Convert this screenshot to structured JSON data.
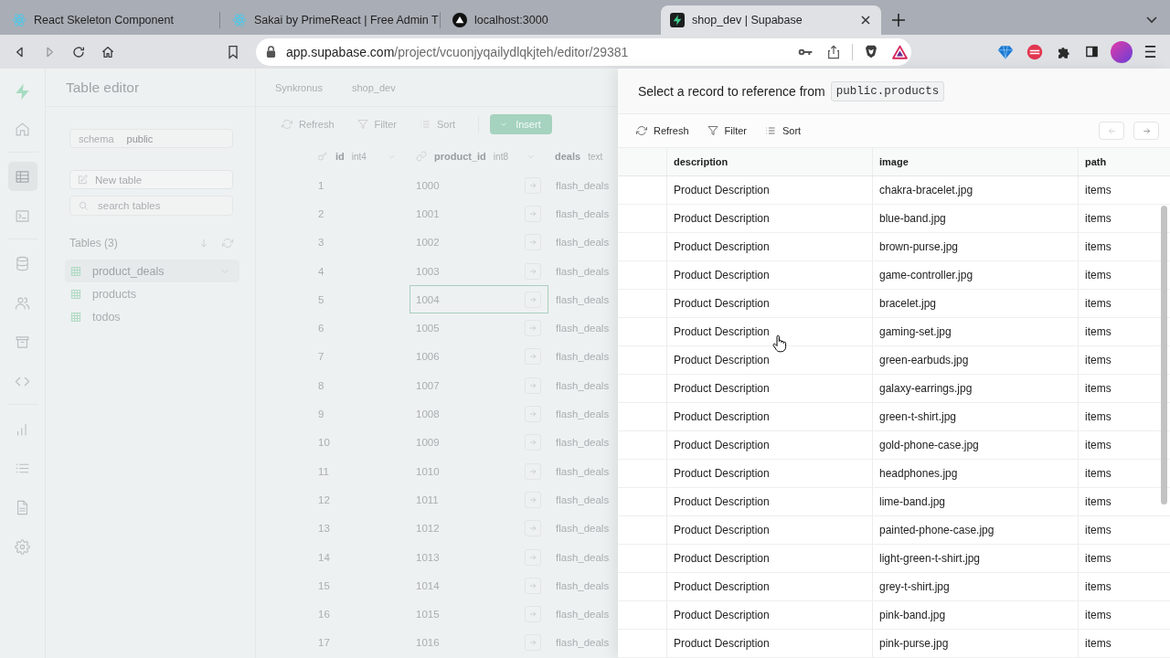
{
  "browser": {
    "tabs": [
      {
        "title": "React Skeleton Component",
        "kind": "atom",
        "selected": false
      },
      {
        "title": "Sakai by PrimeReact | Free Admin T",
        "kind": "atom",
        "selected": false
      },
      {
        "title": "localhost:3000",
        "kind": "triangle",
        "selected": false
      },
      {
        "title": "shop_dev | Supabase",
        "kind": "bolt",
        "selected": true
      }
    ],
    "nav": [
      {
        "kind": "back",
        "disabled": false
      },
      {
        "kind": "forward",
        "disabled": true
      },
      {
        "kind": "reload",
        "disabled": false
      },
      {
        "kind": "home",
        "disabled": false
      }
    ],
    "url": {
      "host": "app.supabase.com",
      "path": "/project/vcuonjyqailydlqkjteh/editor/29381"
    }
  },
  "rail": {
    "groups": [
      [
        {
          "kind": "home",
          "selected": false
        }
      ],
      [
        {
          "kind": "table",
          "selected": true
        },
        {
          "kind": "terminal",
          "selected": false
        }
      ],
      [
        {
          "kind": "database",
          "selected": false
        },
        {
          "kind": "users",
          "selected": false
        },
        {
          "kind": "archive",
          "selected": false
        },
        {
          "kind": "code",
          "selected": false
        }
      ],
      [
        {
          "kind": "chart",
          "selected": false
        },
        {
          "kind": "list",
          "selected": false
        },
        {
          "kind": "document",
          "selected": false
        },
        {
          "kind": "settings",
          "selected": false
        }
      ]
    ]
  },
  "sidebar": {
    "title": "Table editor",
    "schema": {
      "label": "schema",
      "value": "public"
    },
    "new_table": "New table",
    "search": {
      "placeholder": "search tables"
    },
    "tables_heading": "Tables (3)",
    "tables": [
      {
        "name": "product_deals",
        "selected": true
      },
      {
        "name": "products",
        "selected": false
      },
      {
        "name": "todos",
        "selected": false
      }
    ]
  },
  "editor": {
    "breadcrumbs": [
      "Synkronus",
      "shop_dev"
    ],
    "toolbar": {
      "refresh": "Refresh",
      "filter": "Filter",
      "sort": "Sort",
      "insert": "Insert"
    },
    "columns": [
      {
        "name": "id",
        "type": "int4",
        "kind": "key"
      },
      {
        "name": "product_id",
        "type": "int8",
        "kind": "link"
      },
      {
        "name": "deals",
        "type": "text",
        "kind": "plain"
      }
    ],
    "rows": [
      {
        "cells": [
          "1",
          "1000",
          "flash_deals"
        ],
        "selected": false
      },
      {
        "cells": [
          "2",
          "1001",
          "flash_deals"
        ],
        "selected": false
      },
      {
        "cells": [
          "3",
          "1002",
          "flash_deals"
        ],
        "selected": false
      },
      {
        "cells": [
          "4",
          "1003",
          "flash_deals"
        ],
        "selected": false
      },
      {
        "cells": [
          "5",
          "1004",
          "flash_deals"
        ],
        "selected": true
      },
      {
        "cells": [
          "6",
          "1005",
          "flash_deals"
        ],
        "selected": false
      },
      {
        "cells": [
          "7",
          "1006",
          "flash_deals"
        ],
        "selected": false
      },
      {
        "cells": [
          "8",
          "1007",
          "flash_deals"
        ],
        "selected": false
      },
      {
        "cells": [
          "9",
          "1008",
          "flash_deals"
        ],
        "selected": false
      },
      {
        "cells": [
          "10",
          "1009",
          "flash_deals"
        ],
        "selected": false
      },
      {
        "cells": [
          "11",
          "1010",
          "flash_deals"
        ],
        "selected": false
      },
      {
        "cells": [
          "12",
          "1011",
          "flash_deals"
        ],
        "selected": false
      },
      {
        "cells": [
          "13",
          "1012",
          "flash_deals"
        ],
        "selected": false
      },
      {
        "cells": [
          "14",
          "1013",
          "flash_deals"
        ],
        "selected": false
      },
      {
        "cells": [
          "15",
          "1014",
          "flash_deals"
        ],
        "selected": false
      },
      {
        "cells": [
          "16",
          "1015",
          "flash_deals"
        ],
        "selected": false
      },
      {
        "cells": [
          "17",
          "1016",
          "flash_deals"
        ],
        "selected": false
      }
    ]
  },
  "reference_panel": {
    "title": "Select a record to reference from",
    "table": "public.products",
    "toolbar": {
      "refresh": "Refresh",
      "filter": "Filter",
      "sort": "Sort"
    },
    "pager": [
      {
        "kind": "previous",
        "disabled": true
      },
      {
        "kind": "next",
        "disabled": false
      }
    ],
    "columns": [
      "description",
      "image",
      "path"
    ],
    "rows": [
      [
        "Product Description",
        "chakra-bracelet.jpg",
        "items"
      ],
      [
        "Product Description",
        "blue-band.jpg",
        "items"
      ],
      [
        "Product Description",
        "brown-purse.jpg",
        "items"
      ],
      [
        "Product Description",
        "game-controller.jpg",
        "items"
      ],
      [
        "Product Description",
        "bracelet.jpg",
        "items"
      ],
      [
        "Product Description",
        "gaming-set.jpg",
        "items"
      ],
      [
        "Product Description",
        "green-earbuds.jpg",
        "items"
      ],
      [
        "Product Description",
        "galaxy-earrings.jpg",
        "items"
      ],
      [
        "Product Description",
        "green-t-shirt.jpg",
        "items"
      ],
      [
        "Product Description",
        "gold-phone-case.jpg",
        "items"
      ],
      [
        "Product Description",
        "headphones.jpg",
        "items"
      ],
      [
        "Product Description",
        "lime-band.jpg",
        "items"
      ],
      [
        "Product Description",
        "painted-phone-case.jpg",
        "items"
      ],
      [
        "Product Description",
        "light-green-t-shirt.jpg",
        "items"
      ],
      [
        "Product Description",
        "grey-t-shirt.jpg",
        "items"
      ],
      [
        "Product Description",
        "pink-band.jpg",
        "items"
      ],
      [
        "Product Description",
        "pink-purse.jpg",
        "items"
      ]
    ]
  }
}
